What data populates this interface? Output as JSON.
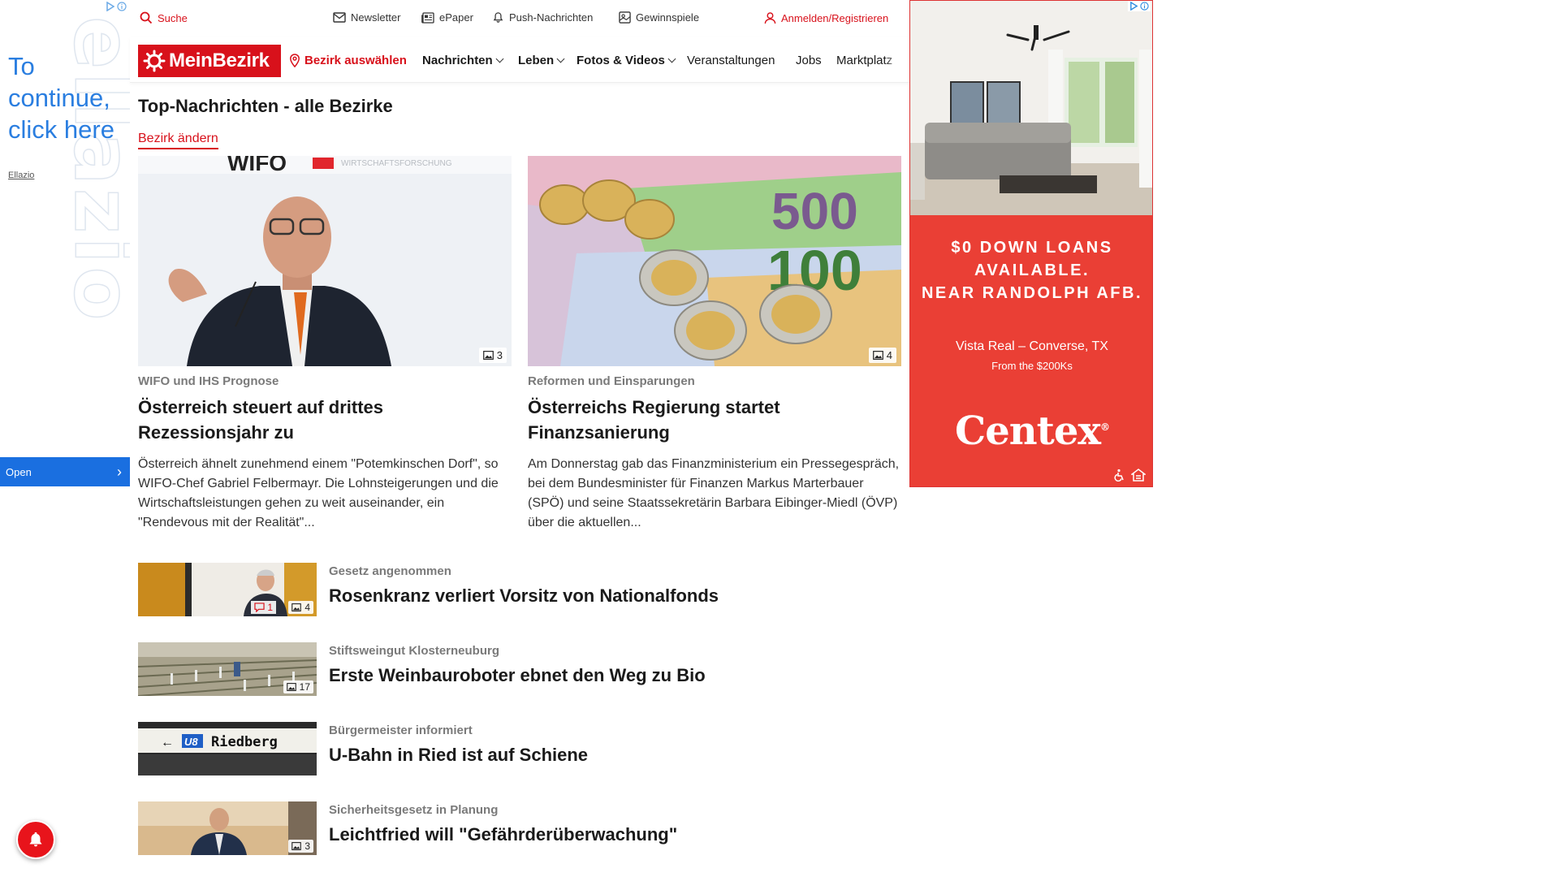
{
  "left_ad": {
    "cta": "To continue, click here",
    "brand": "Ellazio",
    "bg_word": "ellazio",
    "open_label": "Open"
  },
  "utility": {
    "search": "Suche",
    "newsletter": "Newsletter",
    "epaper": "ePaper",
    "push": "Push-Nachrichten",
    "contests": "Gewinnspiele",
    "login": "Anmelden/Registrieren"
  },
  "nav": {
    "logo": "MeinBezirk",
    "choose_district": "Bezirk auswählen",
    "items": [
      {
        "label": "Nachrichten",
        "dropdown": true
      },
      {
        "label": "Leben",
        "dropdown": true
      },
      {
        "label": "Fotos & Videos",
        "dropdown": true
      },
      {
        "label": "Veranstaltungen",
        "dropdown": false
      },
      {
        "label": "Jobs",
        "dropdown": false
      },
      {
        "label": "Marktplatz",
        "dropdown": false
      }
    ]
  },
  "page": {
    "title": "Top-Nachrichten - alle Bezirke",
    "change_district": "Bezirk ändern"
  },
  "featured": [
    {
      "image_text": "WIFO",
      "image_subtext": "WIRTSCHAFTSFORSCHUNG",
      "photo_count": "3",
      "kicker": "WIFO und IHS Prognose",
      "headline": "Österreich steuert auf drittes Rezessionsjahr zu",
      "teaser": "Österreich ähnelt zunehmend einem \"Potemkinschen Dorf\", so WIFO-Chef Gabriel Felbermayr. Die Lohnsteigerungen und die Wirtschaftsleistungen gehen zu weit auseinander, ein \"Rendevous mit der Realität\"..."
    },
    {
      "image_text": "500",
      "image_subtext": "100",
      "photo_count": "4",
      "kicker": "Reformen und Einsparungen",
      "headline": "Österreichs Regierung startet Finanzsanierung",
      "teaser": "Am Donnerstag gab das Finanzministerium ein Pressegespräch, bei dem Bundesminister für Finanzen Markus Marterbauer (SPÖ) und seine Staatssekretärin Barbara Eibinger-Miedl (ÖVP) über die aktuellen..."
    }
  ],
  "list": [
    {
      "kicker": "Gesetz angenommen",
      "headline": "Rosenkranz verliert Vorsitz von Nationalfonds",
      "comments": "1",
      "photo_count": "4"
    },
    {
      "kicker": "Stiftsweingut Klosterneuburg",
      "headline": "Erste Weinbauroboter ebnet den Weg zu Bio",
      "comments": "",
      "photo_count": "17"
    },
    {
      "kicker": "Bürgermeister informiert",
      "headline": "U-Bahn in Ried ist auf Schiene",
      "comments": "",
      "photo_count": "",
      "sign_line": "U8",
      "sign_text": "Riedberg"
    },
    {
      "kicker": "Sicherheitsgesetz in Planung",
      "headline": "Leichtfried will \"Gefährderüberwachung\"",
      "comments": "",
      "photo_count": "3"
    }
  ],
  "right_ad": {
    "headline_line1": "$0 DOWN LOANS",
    "headline_line2": "AVAILABLE.",
    "headline_line3": "NEAR RANDOLPH AFB.",
    "location": "Vista Real – Converse, TX",
    "price": "From the $200Ks",
    "brand": "Centex",
    "brand_mark": "®"
  },
  "colors": {
    "brand_red": "#d8111b",
    "ad_red": "#ea3f35",
    "ad_blue": "#1a6fe0",
    "kicker_gray": "#7a7a7a"
  }
}
